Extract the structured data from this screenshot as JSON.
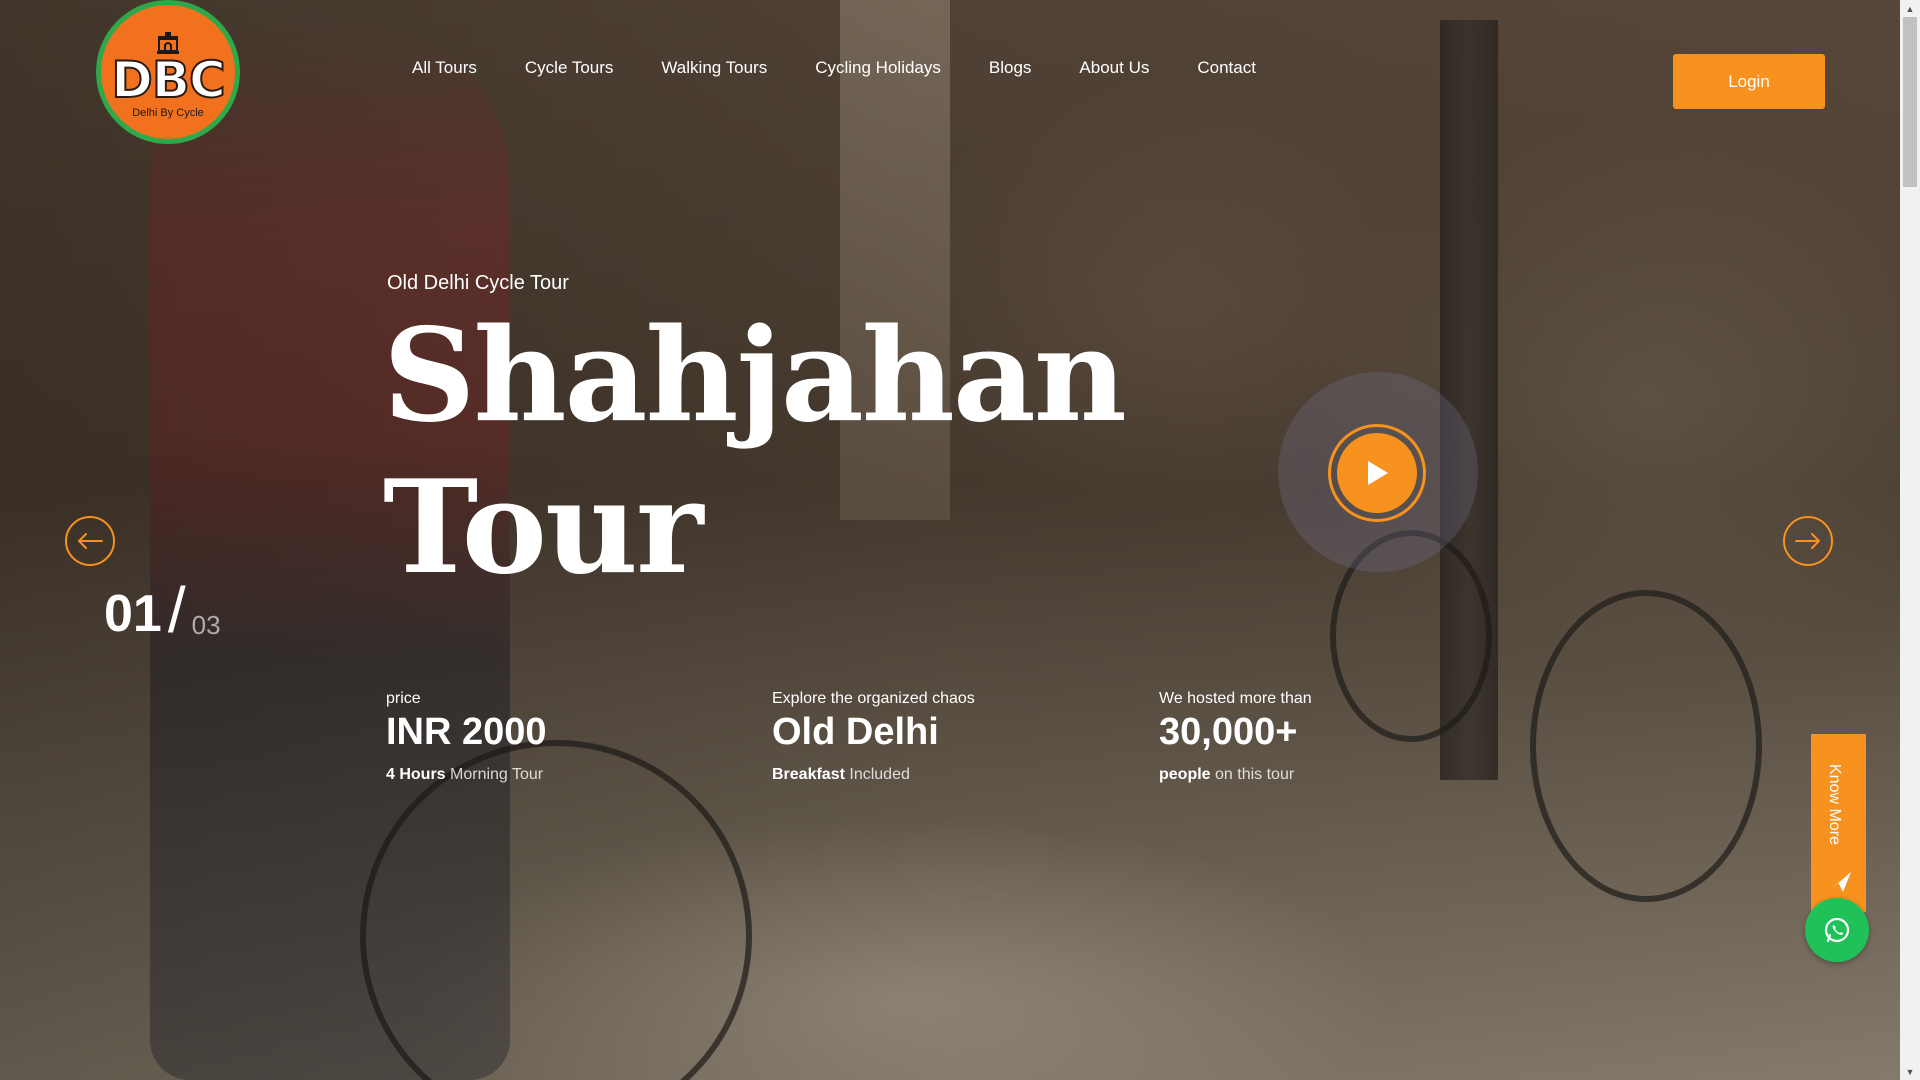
{
  "brand": {
    "logo_text": "DBC",
    "logo_subtitle": "Delhi By Cycle"
  },
  "nav": {
    "items": [
      {
        "label": "All Tours"
      },
      {
        "label": "Cycle Tours"
      },
      {
        "label": "Walking Tours"
      },
      {
        "label": "Cycling Holidays"
      },
      {
        "label": "Blogs"
      },
      {
        "label": "About Us"
      },
      {
        "label": "Contact"
      }
    ],
    "login_label": "Login"
  },
  "hero": {
    "subtitle": "Old Delhi Cycle Tour",
    "title_line1": "Shahjahan",
    "title_line2": "Tour",
    "slide_current": "01",
    "slide_separator": "/",
    "slide_total": "03"
  },
  "stats": [
    {
      "label": "price",
      "value": "INR 2000",
      "note_bold": "4 Hours",
      "note_rest": " Morning Tour"
    },
    {
      "label": "Explore the organized chaos",
      "value": "Old Delhi",
      "note_bold": "Breakfast",
      "note_rest": " Included"
    },
    {
      "label": "We hosted more than",
      "value": "30,000+",
      "note_bold": "people",
      "note_rest": " on this tour"
    }
  ],
  "side": {
    "know_more_label": "Know More"
  },
  "colors": {
    "accent": "#f7921e",
    "logo_bg": "#f1711f",
    "logo_ring": "#2fa84a",
    "whatsapp": "#21c15a"
  },
  "icons": {
    "prev": "arrow-left-icon",
    "next": "arrow-right-icon",
    "play": "play-icon",
    "know_more": "paper-plane-icon",
    "whatsapp": "whatsapp-icon",
    "logo": "india-gate-icon"
  }
}
